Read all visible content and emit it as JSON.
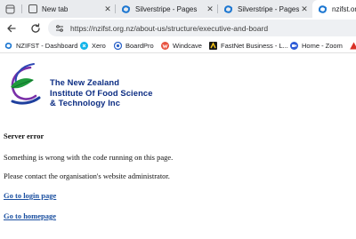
{
  "tabs": [
    {
      "title": "",
      "icon": "tab-groups-icon"
    },
    {
      "title": "New tab",
      "icon": "new-tab-page-icon"
    },
    {
      "title": "Silverstripe - Pages",
      "icon": "silverstripe-icon"
    },
    {
      "title": "Silverstripe - Pages",
      "icon": "silverstripe-icon"
    },
    {
      "title": "nzifst.org",
      "icon": "silverstripe-icon",
      "active": true
    }
  ],
  "address_bar": {
    "url": "https://nzifst.org.nz/about-us/structure/executive-and-board"
  },
  "bookmarks": [
    {
      "label": "NZIFST - Dashboard",
      "icon": "silverstripe-icon"
    },
    {
      "label": "Xero",
      "icon": "xero-icon"
    },
    {
      "label": "BoardPro",
      "icon": "boardpro-icon"
    },
    {
      "label": "Windcave",
      "icon": "windcave-icon"
    },
    {
      "label": "FastNet Business - L...",
      "icon": "fastnet-icon"
    },
    {
      "label": "Home - Zoom",
      "icon": "zoom-icon"
    }
  ],
  "logo": {
    "lines": [
      "The New Zealand",
      "Institute Of Food Science",
      "& Technology Inc"
    ]
  },
  "error": {
    "heading": "Server error",
    "message": "Something is wrong with the code running on this page.",
    "contact": "Please contact the organisation's website administrator.",
    "login_link": "Go to login page",
    "home_link": "Go to homepage"
  },
  "colors": {
    "logo_blue": "#0c2d83",
    "link_blue": "#1a4fa0",
    "tab_strip": "#e9ebee"
  }
}
